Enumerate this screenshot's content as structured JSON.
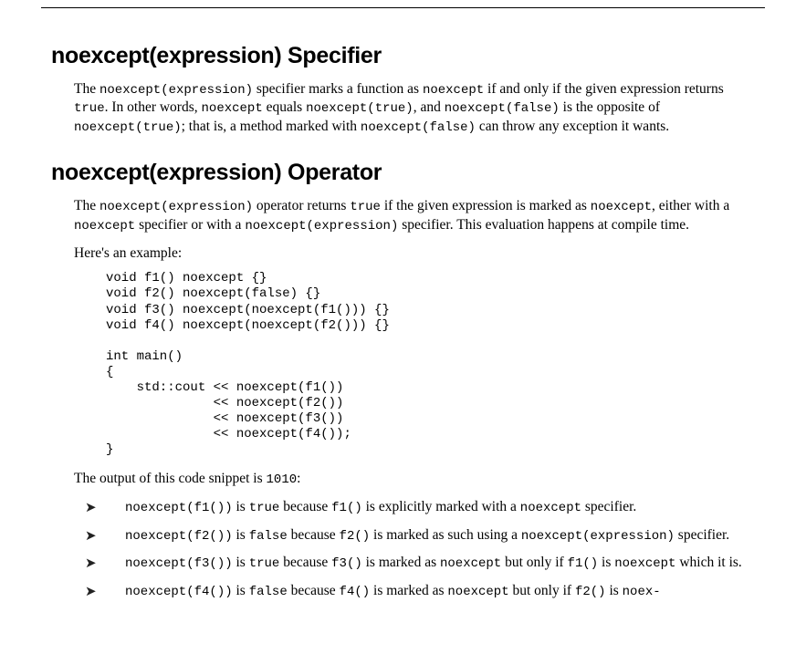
{
  "section1": {
    "heading": "noexcept(expression) Specifier",
    "para_parts": [
      "The ",
      "noexcept(expression)",
      " specifier marks a function as ",
      "noexcept",
      " if and only if the given expression returns ",
      "true",
      ". In other words, ",
      "noexcept",
      " equals ",
      "noexcept(true)",
      ", and ",
      "noexcept(false)",
      " is the opposite of ",
      "noexcept(true)",
      "; that is, a method marked with ",
      "noexcept(false)",
      " can throw any exception it wants."
    ]
  },
  "section2": {
    "heading": "noexcept(expression) Operator",
    "para_parts": [
      "The ",
      "noexcept(expression)",
      " operator returns ",
      "true",
      " if the given expression is marked as ",
      "noexcept",
      ", either with a ",
      "noexcept",
      " specifier or with a ",
      "noexcept(expression)",
      " specifier. This evaluation happens at compile time."
    ],
    "example_intro": "Here's an example:",
    "code": "void f1() noexcept {}\nvoid f2() noexcept(false) {}\nvoid f3() noexcept(noexcept(f1())) {}\nvoid f4() noexcept(noexcept(f2())) {}\n\nint main()\n{\n    std::cout << noexcept(f1())\n              << noexcept(f2())\n              << noexcept(f3())\n              << noexcept(f4());\n}",
    "output_parts": [
      "The output of this code snippet is ",
      "1010",
      ":"
    ],
    "bullets": [
      {
        "parts": [
          "noexcept(f1())",
          " is ",
          "true",
          " because ",
          "f1()",
          " is explicitly marked with a ",
          "noexcept",
          " specifier."
        ]
      },
      {
        "parts": [
          "noexcept(f2())",
          " is ",
          "false",
          " because ",
          "f2()",
          " is marked as such using a ",
          "noexcept(expression)",
          " specifier."
        ]
      },
      {
        "parts": [
          "noexcept(f3())",
          " is ",
          "true",
          " because ",
          "f3()",
          " is marked as ",
          "noexcept",
          " but only if ",
          "f1()",
          " is ",
          "noexcept",
          " which it is."
        ]
      },
      {
        "parts": [
          "noexcept(f4())",
          " is ",
          "false",
          " because ",
          "f4()",
          " is marked as ",
          "noexcept",
          " but only if ",
          "f2()",
          " is ",
          "noex-"
        ]
      }
    ]
  },
  "arrow_glyph": "➤"
}
